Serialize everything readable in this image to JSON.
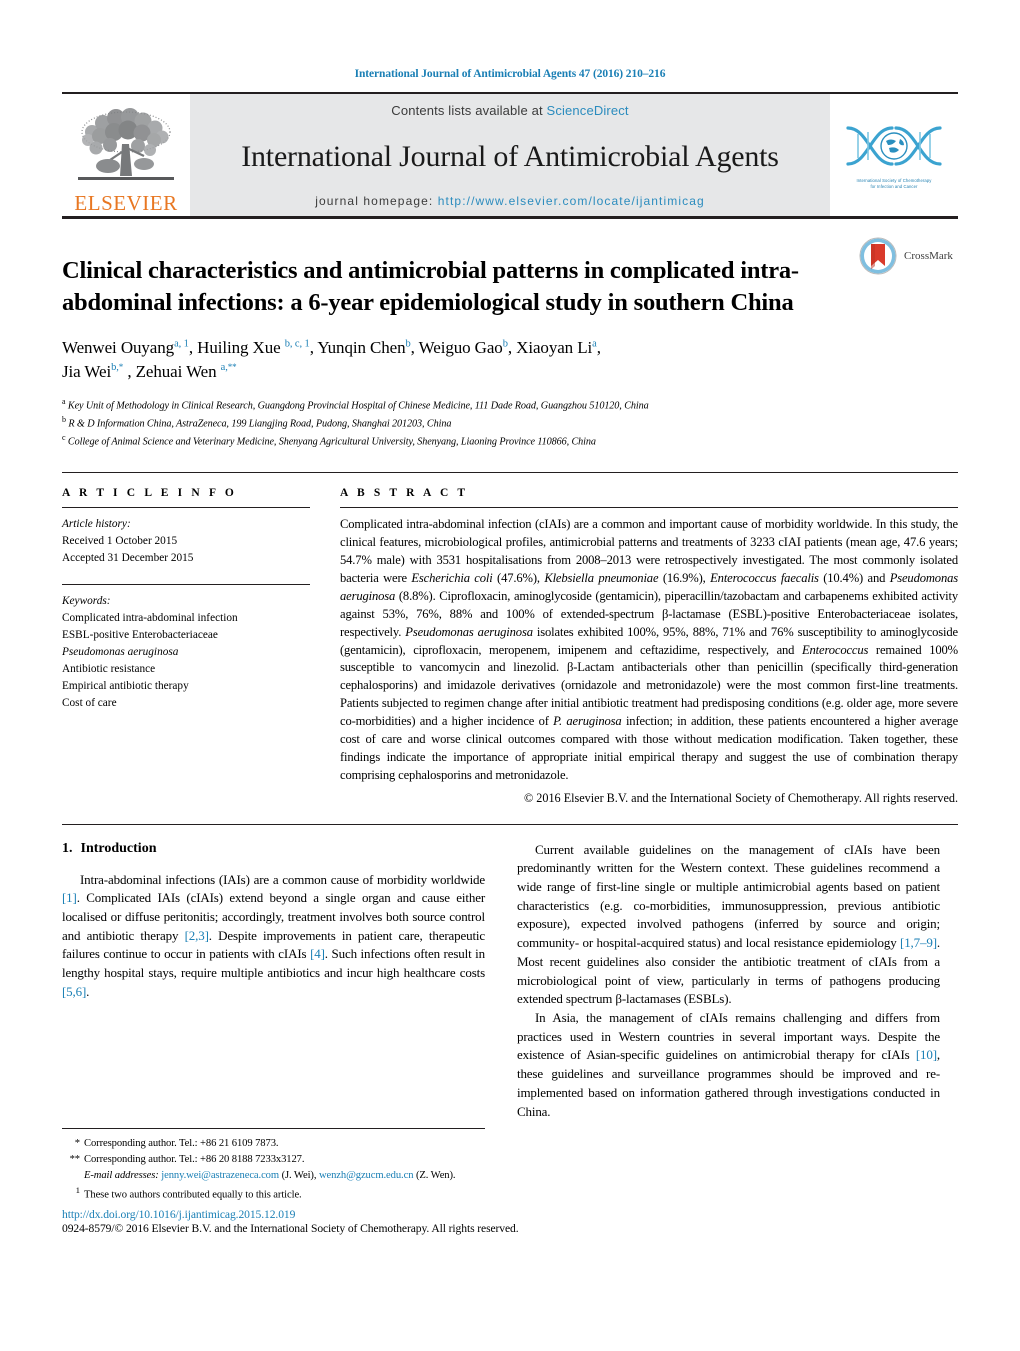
{
  "running_head": "International Journal of Antimicrobial Agents 47 (2016) 210–216",
  "masthead": {
    "contents_prefix": "Contents lists available at ",
    "contents_link": "ScienceDirect",
    "journal_title": "International Journal of Antimicrobial Agents",
    "homepage_label": "journal homepage:",
    "homepage_url": "http://www.elsevier.com/locate/ijantimicag",
    "publisher_logo_text": "ELSEVIER",
    "society_logo_line1": "International Society of Chemotherapy",
    "society_logo_line2": "for Infection and Cancer",
    "accent_color": "#2b8cbe",
    "elsevier_orange": "#e87722"
  },
  "crossmark": {
    "label": "CrossMark"
  },
  "article": {
    "title": "Clinical characteristics and antimicrobial patterns in complicated intra-abdominal infections: a 6-year epidemiological study in southern China",
    "authors_line1_parts": [
      {
        "name": "Wenwei Ouyang",
        "sup": "a, 1",
        "sep": ", "
      },
      {
        "name": "Huiling Xue",
        "sup": "b, c, 1",
        "sep": ", "
      },
      {
        "name": "Yunqin Chen",
        "sup": "b",
        "sep": ", "
      },
      {
        "name": "Weiguo Gao",
        "sup": "b",
        "sep": ", "
      },
      {
        "name": "Xiaoyan Li",
        "sup": "a",
        "sep": ","
      }
    ],
    "authors_line2_parts": [
      {
        "name": "Jia Wei",
        "sup": "b,*",
        "sep": " , "
      },
      {
        "name": "Zehuai Wen",
        "sup": "a,**",
        "sep": ""
      }
    ],
    "affiliations": [
      {
        "mark": "a",
        "text": "Key Unit of Methodology in Clinical Research, Guangdong Provincial Hospital of Chinese Medicine, 111 Dade Road, Guangzhou 510120, China"
      },
      {
        "mark": "b",
        "text": "R & D Information China, AstraZeneca, 199 Liangjing Road, Pudong, Shanghai 201203, China"
      },
      {
        "mark": "c",
        "text": "College of Animal Science and Veterinary Medicine, Shenyang Agricultural University, Shenyang, Liaoning Province 110866, China"
      }
    ]
  },
  "article_info": {
    "heading": "A R T I C L E   I N F O",
    "history_label": "Article history:",
    "received": "Received 1 October 2015",
    "accepted": "Accepted 31 December 2015",
    "keywords_label": "Keywords:",
    "keywords": [
      {
        "text": "Complicated intra-abdominal infection",
        "italic": false
      },
      {
        "text": "ESBL-positive Enterobacteriaceae",
        "italic": false
      },
      {
        "text": "Pseudomonas aeruginosa",
        "italic": true
      },
      {
        "text": "Antibiotic resistance",
        "italic": false
      },
      {
        "text": "Empirical antibiotic therapy",
        "italic": false
      },
      {
        "text": "Cost of care",
        "italic": false
      }
    ]
  },
  "abstract": {
    "heading": "A B S T R A C T",
    "html": "Complicated intra-abdominal infection (cIAIs) are a common and important cause of morbidity worldwide. In this study, the clinical features, microbiological profiles, antimicrobial patterns and treatments of 3233 cIAI patients (mean age, 47.6 years; 54.7% male) with 3531 hospitalisations from 2008–2013 were retrospectively investigated. The most commonly isolated bacteria were <i>Escherichia coli</i> (47.6%), <i>Klebsiella pneumoniae</i> (16.9%), <i>Enterococcus faecalis</i> (10.4%) and <i>Pseudomonas aeruginosa</i> (8.8%). Ciprofloxacin, aminoglycoside (gentamicin), piperacillin/tazobactam and carbapenems exhibited activity against 53%, 76%, 88% and 100% of extended-spectrum β-lactamase (ESBL)-positive Enterobacteriaceae isolates, respectively. <i>Pseudomonas aeruginosa</i> isolates exhibited 100%, 95%, 88%, 71% and 76% susceptibility to aminoglycoside (gentamicin), ciprofloxacin, meropenem, imipenem and ceftazidime, respectively, and <i>Enterococcus</i> remained 100% susceptible to vancomycin and linezolid. β-Lactam antibacterials other than penicillin (specifically third-generation cephalosporins) and imidazole derivatives (ornidazole and metronidazole) were the most common first-line treatments. Patients subjected to regimen change after initial antibiotic treatment had predisposing conditions (e.g. older age, more severe co-morbidities) and a higher incidence of <i>P. aeruginosa</i> infection; in addition, these patients encountered a higher average cost of care and worse clinical outcomes compared with those without medication modification. Taken together, these findings indicate the importance of appropriate initial empirical therapy and suggest the use of combination therapy comprising cephalosporins and metronidazole.",
    "copyright": "© 2016 Elsevier B.V. and the International Society of Chemotherapy. All rights reserved."
  },
  "introduction": {
    "number": "1.",
    "heading": "Introduction",
    "left_paragraphs": [
      "Intra-abdominal infections (IAIs) are a common cause of morbidity worldwide <span class=\"ref\">[1]</span>. Complicated IAIs (cIAIs) extend beyond a single organ and cause either localised or diffuse peritonitis; accordingly, treatment involves both source control and antibiotic therapy <span class=\"ref\">[2,3]</span>. Despite improvements in patient care, therapeutic failures continue to occur in patients with cIAIs <span class=\"ref\">[4]</span>. Such infections often result in lengthy hospital stays, require multiple antibiotics and incur high healthcare costs <span class=\"ref\">[5,6]</span>."
    ],
    "right_paragraphs": [
      "Current available guidelines on the management of cIAIs have been predominantly written for the Western context. These guidelines recommend a wide range of first-line single or multiple antimicrobial agents based on patient characteristics (e.g. co-morbidities, immunosuppression, previous antibiotic exposure), expected involved pathogens (inferred by source and origin; community- or hospital-acquired status) and local resistance epidemiology <span class=\"ref\">[1,7–9]</span>. Most recent guidelines also consider the antibiotic treatment of cIAIs from a microbiological point of view, particularly in terms of pathogens producing extended spectrum β-lactamases (ESBLs).",
      "In Asia, the management of cIAIs remains challenging and differs from practices used in Western countries in several important ways. Despite the existence of Asian-specific guidelines on antimicrobial therapy for cIAIs <span class=\"ref\">[10]</span>, these guidelines and surveillance programmes should be improved and re-implemented based on information gathered through investigations conducted in China."
    ]
  },
  "footnotes": [
    {
      "mark": "*",
      "html": "Corresponding author. Tel.: +86 21 6109 7873."
    },
    {
      "mark": "**",
      "html": "Corresponding author. Tel.: +86 20 8188 7233x3127."
    },
    {
      "mark": "",
      "html": "<i>E-mail addresses:</i> <span class=\"link\">jenny.wei@astrazeneca.com</span> (J. Wei), <span class=\"link\">wenzh@gzucm.edu.cn</span> (Z. Wen)."
    },
    {
      "mark": "1",
      "html": "These two authors contributed equally to this article."
    }
  ],
  "footer": {
    "doi": "http://dx.doi.org/10.1016/j.ijantimicag.2015.12.019",
    "issn_line": "0924-8579/© 2016 Elsevier B.V. and the International Society of Chemotherapy. All rights reserved."
  }
}
